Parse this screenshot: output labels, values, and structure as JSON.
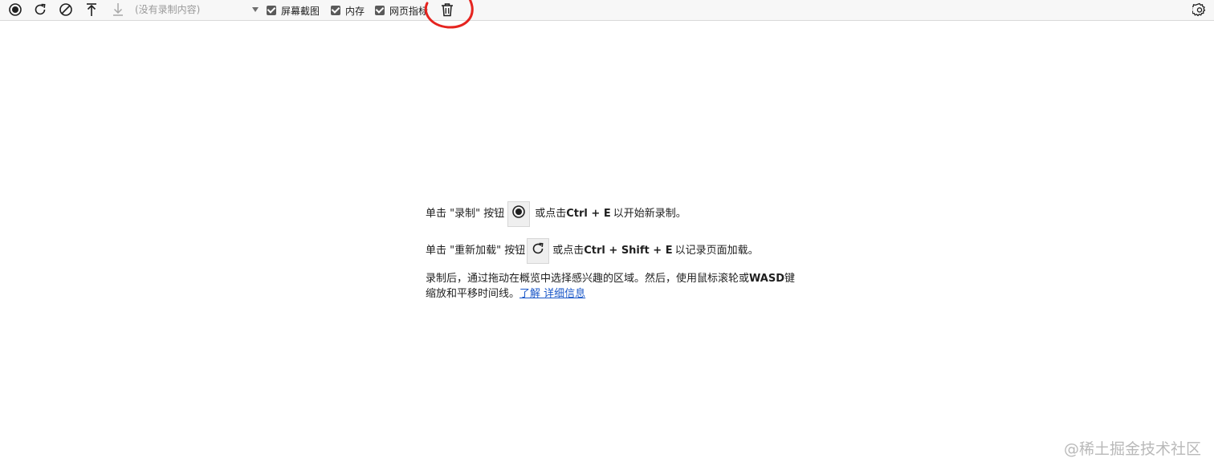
{
  "toolbar": {
    "recording_select": {
      "selected": "(没有录制内容)"
    },
    "checkboxes": [
      {
        "label": "屏幕截图",
        "checked": true
      },
      {
        "label": "内存",
        "checked": true
      },
      {
        "label": "网页指标",
        "checked": true
      }
    ],
    "icons": {
      "record": "record-icon",
      "reload": "reload-icon",
      "clear": "clear-icon",
      "upload": "upload-icon",
      "download": "download-icon",
      "trash": "trash-icon",
      "settings": "gear-icon"
    }
  },
  "landing": {
    "line1": {
      "prefix": "单击 \"录制\" 按钮",
      "middle": "或点击",
      "shortcut": "Ctrl + E",
      "suffix": "以开始新录制。"
    },
    "line2": {
      "prefix": "单击 \"重新加载\" 按钮",
      "middle": "或点击",
      "shortcut": "Ctrl + Shift + E",
      "suffix": "以记录页面加载。"
    },
    "note": {
      "part1": "录制后，通过拖动在概览中选择感兴趣的区域。然后，使用鼠标滚轮或",
      "bold": "WASD",
      "part2": "键缩放和平移时间线。",
      "link": "了解 详细信息"
    }
  },
  "watermark": "@稀土掘金技术社区",
  "colors": {
    "annotation": "#e5241f",
    "link": "#1a57c8",
    "toolbar_bg": "#f7f7f7"
  }
}
